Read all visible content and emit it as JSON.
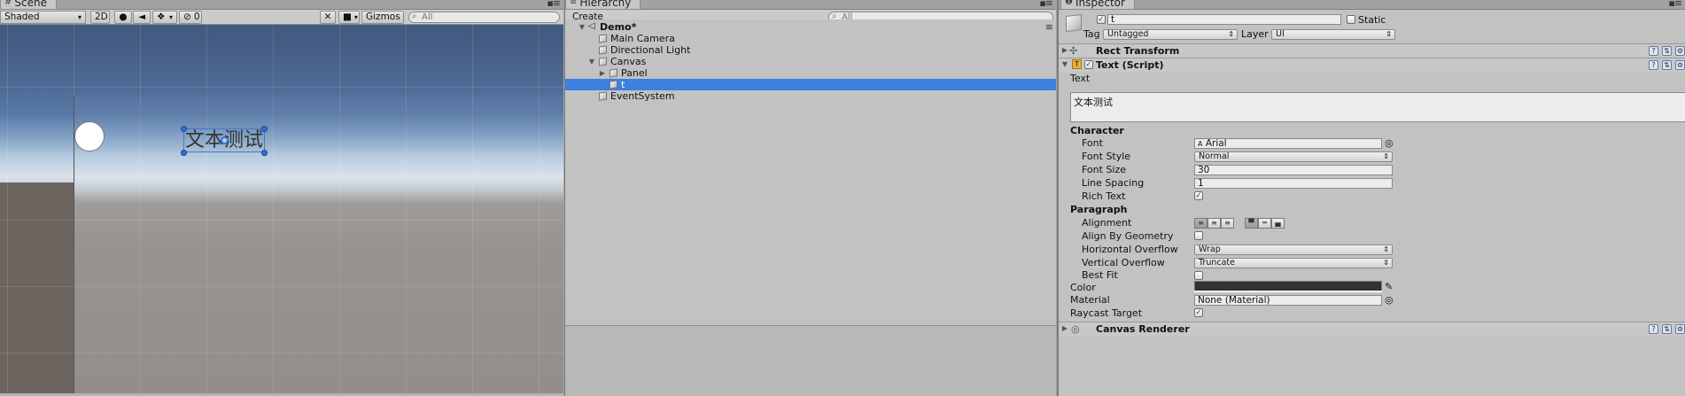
{
  "scene": {
    "tab_label": "Scene",
    "shading_mode": "Shaded",
    "mode_2d": "2D",
    "fx_count": "0",
    "gizmos_label": "Gizmos",
    "search_placeholder": "All",
    "text_object_content": "文本测试"
  },
  "hierarchy": {
    "tab_label": "Hierarchy",
    "create_label": "Create",
    "search_placeholder": "All",
    "scene_name": "Demo*",
    "items": [
      {
        "label": "Main Camera"
      },
      {
        "label": "Directional Light"
      },
      {
        "label": "Canvas"
      },
      {
        "label": "Panel"
      },
      {
        "label": "t"
      },
      {
        "label": "EventSystem"
      }
    ]
  },
  "inspector": {
    "tab_label": "Inspector",
    "object_name": "t",
    "static_label": "Static",
    "tag_label": "Tag",
    "tag_value": "Untagged",
    "layer_label": "Layer",
    "layer_value": "UI",
    "components": {
      "rect_transform": "Rect Transform",
      "text_script": "Text (Script)",
      "canvas_renderer": "Canvas Renderer"
    },
    "text_field_label": "Text",
    "text_value": "文本测试",
    "character_header": "Character",
    "font_label": "Font",
    "font_value": "Arial",
    "font_style_label": "Font Style",
    "font_style_value": "Normal",
    "font_size_label": "Font Size",
    "font_size_value": "30",
    "line_spacing_label": "Line Spacing",
    "line_spacing_value": "1",
    "rich_text_label": "Rich Text",
    "rich_text_checked": true,
    "paragraph_header": "Paragraph",
    "alignment_label": "Alignment",
    "align_by_geometry_label": "Align By Geometry",
    "align_by_geometry_checked": false,
    "horizontal_overflow_label": "Horizontal Overflow",
    "horizontal_overflow_value": "Wrap",
    "vertical_overflow_label": "Vertical Overflow",
    "vertical_overflow_value": "Truncate",
    "best_fit_label": "Best Fit",
    "best_fit_checked": false,
    "color_label": "Color",
    "color_value": "#323232",
    "material_label": "Material",
    "material_value": "None (Material)",
    "raycast_target_label": "Raycast Target",
    "raycast_target_checked": true
  },
  "colors": {
    "selection": "#3d80df",
    "panel_bg": "#c2c2c2"
  }
}
